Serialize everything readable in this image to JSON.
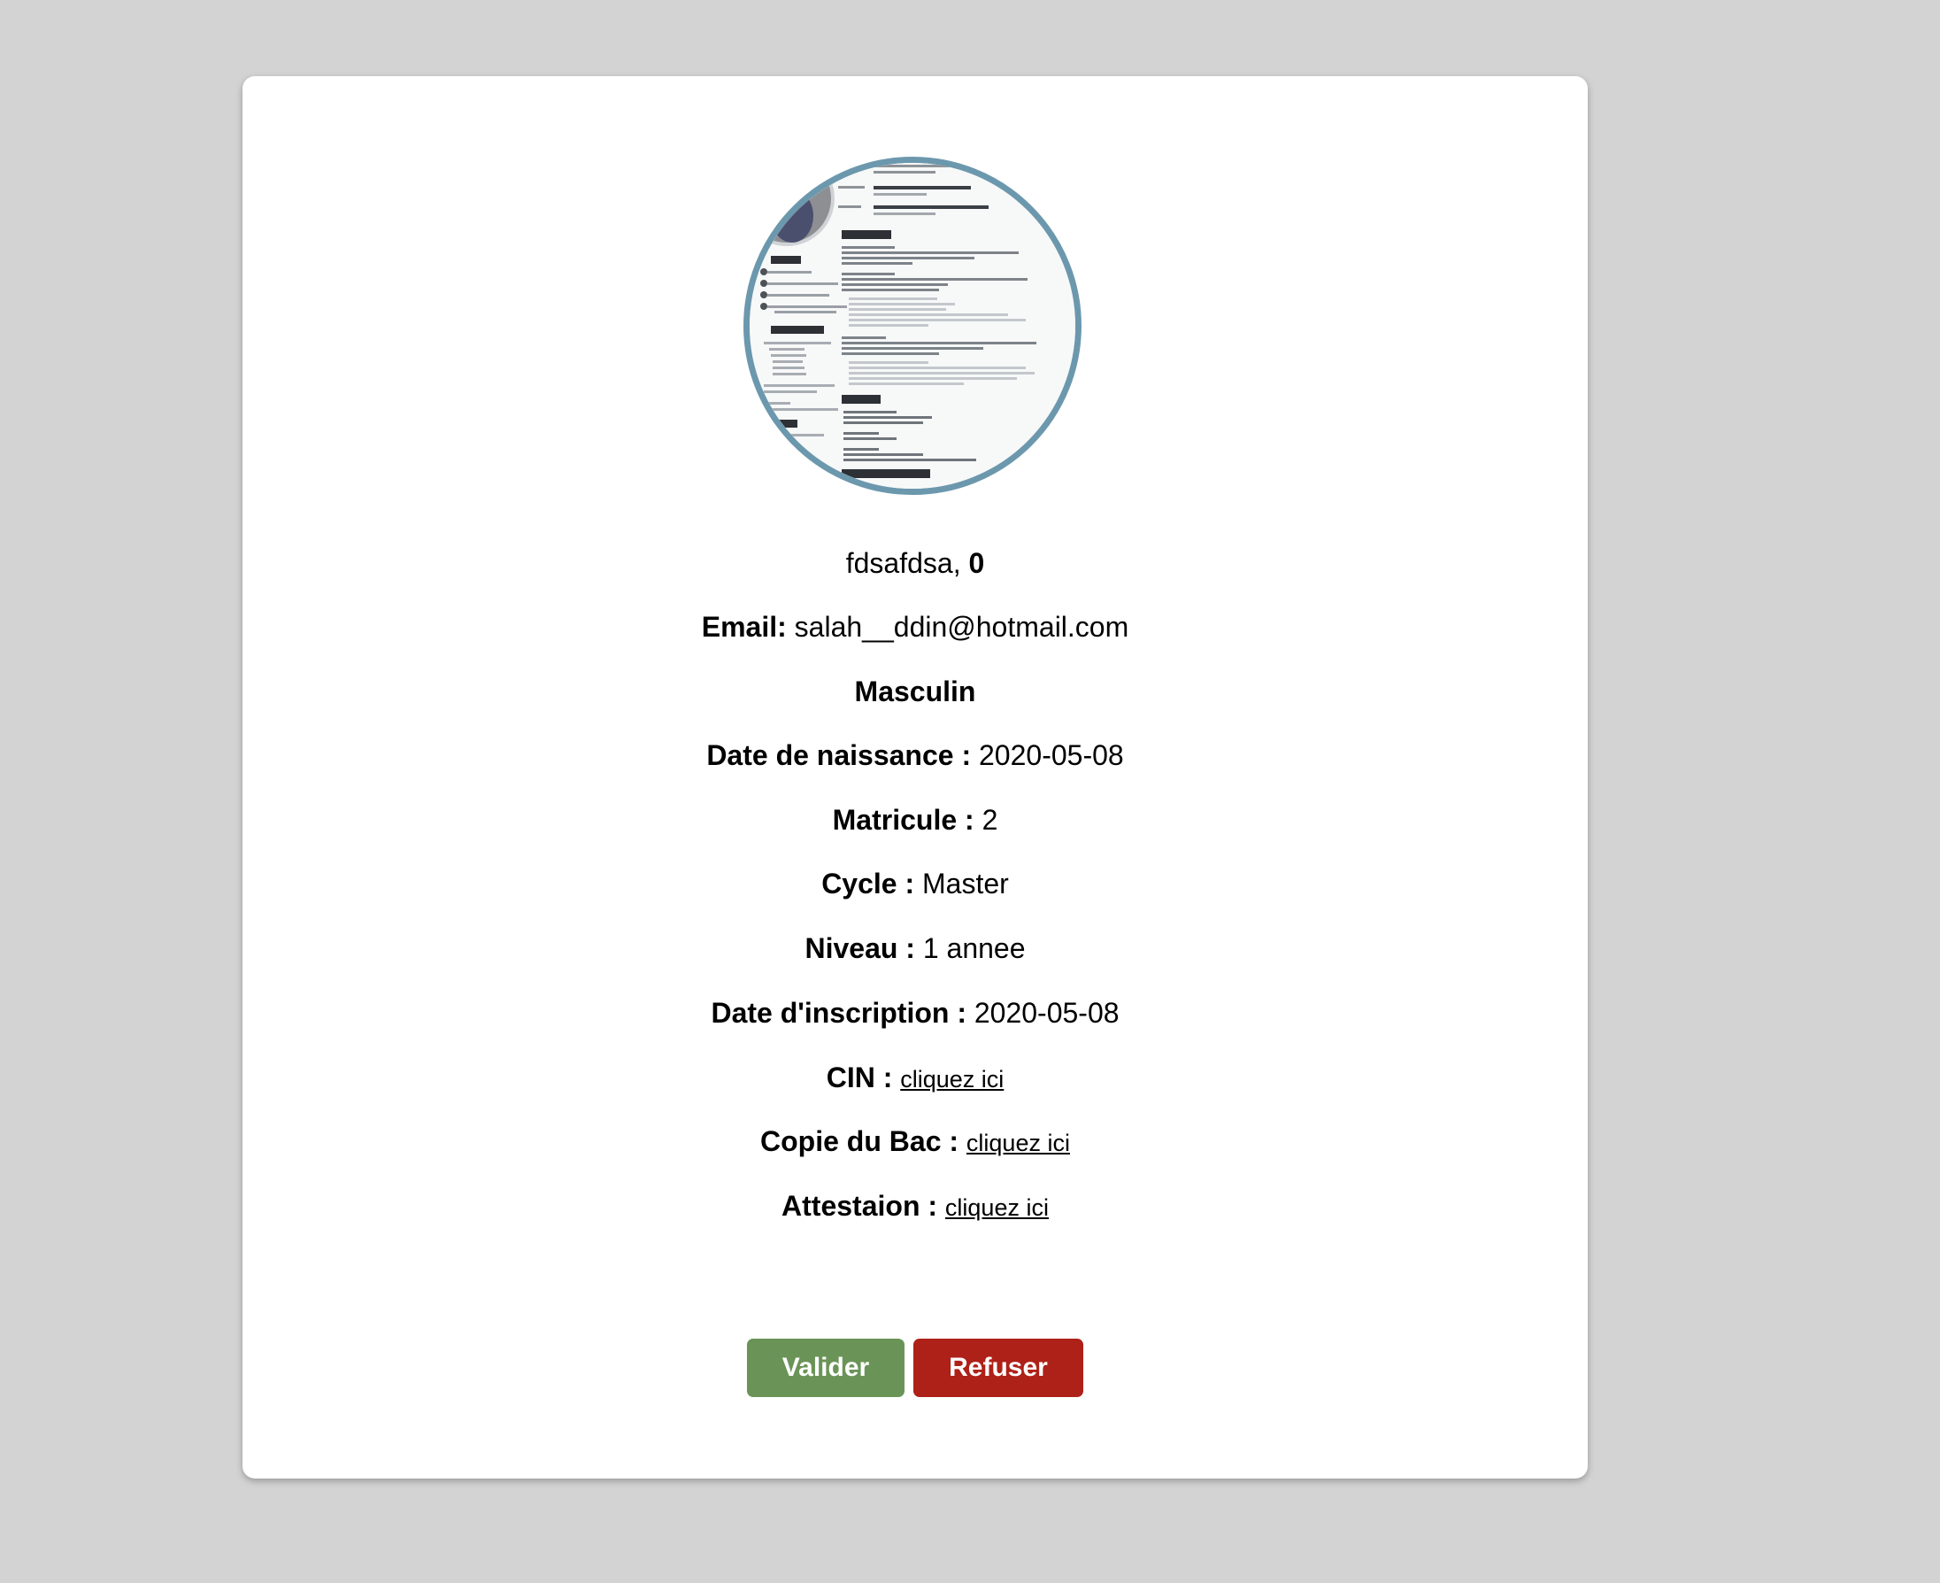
{
  "profile": {
    "name": "fdsafdsa,",
    "id_value": "0",
    "email_label": "Email:",
    "email": "salah__ddin@hotmail.com",
    "gender": "Masculin",
    "birth_label": "Date de naissance :",
    "birth_date": "2020-05-08",
    "matricule_label": "Matricule :",
    "matricule": "2",
    "cycle_label": "Cycle :",
    "cycle": "Master",
    "niveau_label": "Niveau :",
    "niveau": "1 annee",
    "inscription_label": "Date d'inscription :",
    "inscription_date": "2020-05-08"
  },
  "documents": {
    "cin_label": "CIN :",
    "bac_label": "Copie du Bac :",
    "attestation_label": "Attestaion :",
    "link_text": "cliquez ici"
  },
  "actions": {
    "validate_label": "Valider",
    "refuse_label": "Refuser"
  },
  "colors": {
    "page_background": "#d3d3d3",
    "avatar_border": "#6c98ae",
    "validate": "#6a9457",
    "refuse": "#ae2118"
  }
}
